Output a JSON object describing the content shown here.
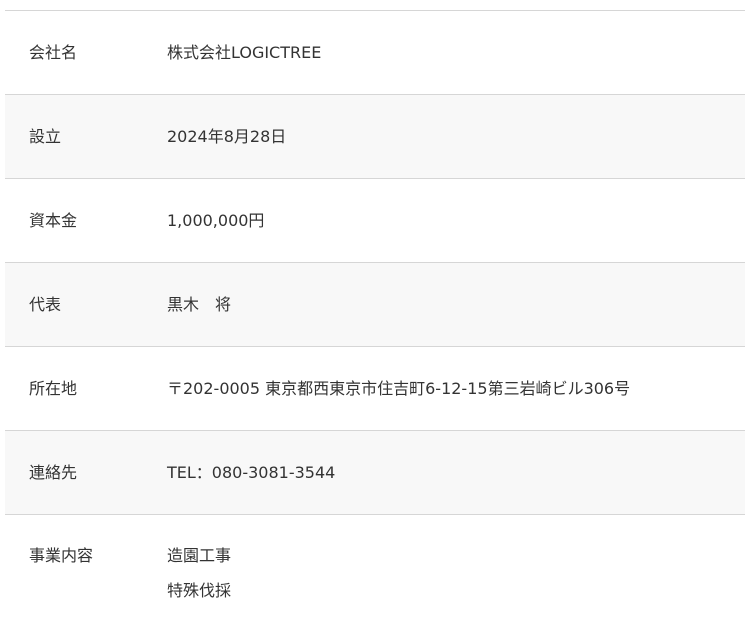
{
  "company_profile": {
    "rows": [
      {
        "label": "会社名",
        "value": "株式会社LOGICTREE"
      },
      {
        "label": "設立",
        "value": "2024年8月28日"
      },
      {
        "label": "資本金",
        "value": "1,000,000円"
      },
      {
        "label": "代表",
        "value": "黒木　将"
      },
      {
        "label": "所在地",
        "value": "〒202-0005 東京都西東京市住吉町6-12-15第三岩崎ビル306号"
      },
      {
        "label": "連絡先",
        "value": "TEL：080-3081-3544"
      },
      {
        "label": "事業内容",
        "values": [
          "造園工事",
          "特殊伐採"
        ]
      }
    ]
  }
}
